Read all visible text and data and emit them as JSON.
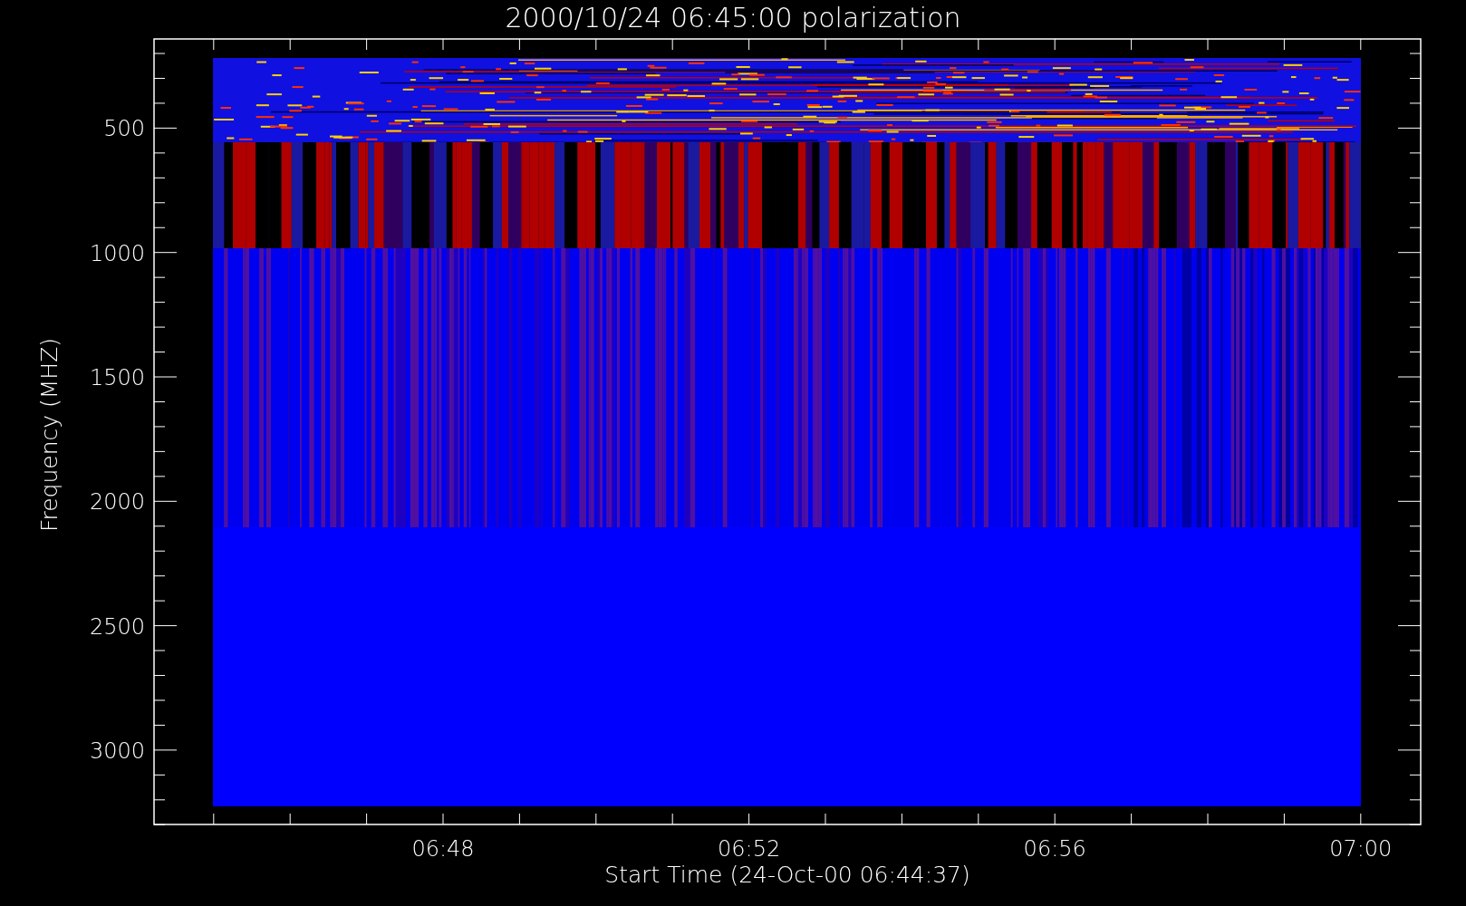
{
  "title": "2000/10/24 06:45:00 polarization",
  "xlabel": "Start Time (24-Oct-00 06:44:37)",
  "ylabel": "Frequency (MHZ)",
  "xticks": [
    "06:48",
    "06:52",
    "06:56",
    "07:00"
  ],
  "yticks": [
    "500",
    "1000",
    "1500",
    "2000",
    "2500",
    "3000"
  ]
}
